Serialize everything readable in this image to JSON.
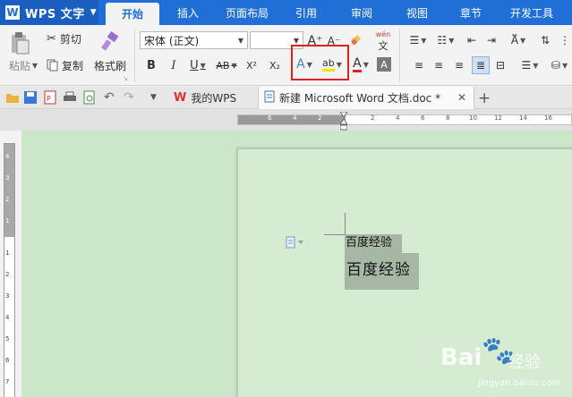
{
  "app": {
    "title": "WPS 文字",
    "logo_letter": "W"
  },
  "menu": {
    "tabs": [
      {
        "label": "开始",
        "active": true
      },
      {
        "label": "插入"
      },
      {
        "label": "页面布局"
      },
      {
        "label": "引用"
      },
      {
        "label": "审阅"
      },
      {
        "label": "视图"
      },
      {
        "label": "章节"
      },
      {
        "label": "开发工具"
      }
    ]
  },
  "ribbon": {
    "paste_label": "粘贴",
    "cut_label": "剪切",
    "copy_label": "复制",
    "format_painter_label": "格式刷",
    "font_name": "宋体 (正文)",
    "font_size": "",
    "bold": "B",
    "italic": "I",
    "underline": "U",
    "strike": "AB",
    "superscript": "X²",
    "subscript": "X₂",
    "grow_font": "A⁺",
    "shrink_font": "A⁻",
    "pinyin": "wén"
  },
  "quickbar": {
    "doc_tabs": [
      {
        "label": "我的WPS"
      },
      {
        "label": "新建 Microsoft Word 文档.doc *",
        "active": true
      }
    ],
    "new_tab": "+"
  },
  "ruler": {
    "h_ticks": [
      "6",
      "4",
      "2",
      "",
      "2",
      "4",
      "6",
      "8",
      "10",
      "12",
      "14",
      "16",
      "18",
      "20"
    ],
    "v_ticks_top": [
      "4",
      "3",
      "2",
      "1"
    ],
    "v_ticks_bottom": [
      "1",
      "2",
      "3",
      "4",
      "5",
      "6",
      "7",
      "8",
      "9"
    ]
  },
  "document": {
    "line1": "百度经验",
    "line2": "百度经验"
  },
  "watermark": {
    "brand": "Bai",
    "brand2": "经验",
    "url": "jingyan.baidu.com"
  },
  "colors": {
    "menubar": "#1f6fd6",
    "workspace": "#cce6c9",
    "selection": "#a6b7a5",
    "highlight_border": "#e02020"
  }
}
